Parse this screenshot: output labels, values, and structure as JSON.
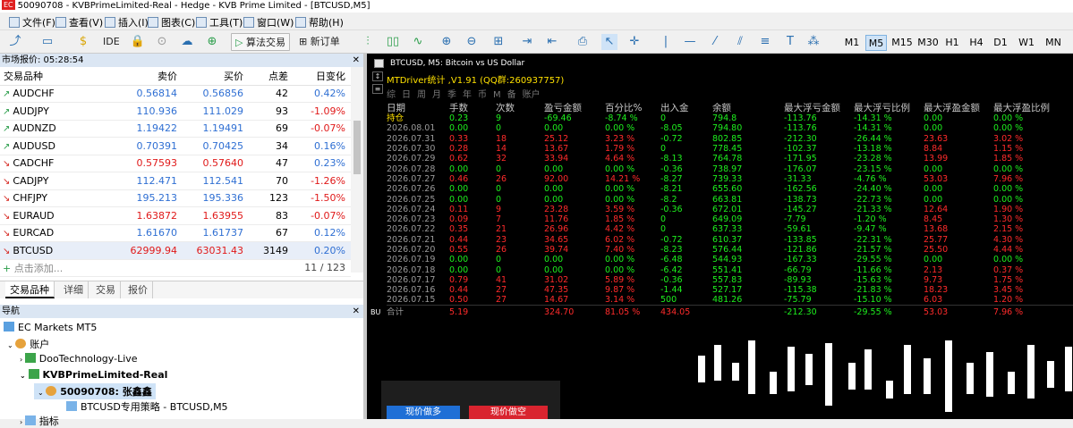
{
  "window_title": "50090708 - KVBPrimeLimited-Real - Hedge - KVB Prime Limited - [BTCUSD,M5]",
  "app_logo": "EC",
  "menu": [
    "文件(F)",
    "查看(V)",
    "插入(I)",
    "图表(C)",
    "工具(T)",
    "窗口(W)",
    "帮助(H)"
  ],
  "toolbar": {
    "ide": "IDE",
    "algo_trading": "算法交易",
    "new_order": "新订单",
    "timeframes": [
      "M1",
      "M5",
      "M15",
      "M30",
      "H1",
      "H4",
      "D1",
      "W1",
      "MN"
    ],
    "active_timeframe": "M5"
  },
  "market_watch": {
    "title": "市场报价: 05:28:54",
    "headers": [
      "交易品种",
      "卖价",
      "买价",
      "点差",
      "日变化"
    ],
    "rows": [
      {
        "symbol": "AUDCHF",
        "dir": "up",
        "bid": "0.56814",
        "ask": "0.56856",
        "spread": "42",
        "change": "0.42%",
        "bid_color": "up",
        "change_color": "up"
      },
      {
        "symbol": "AUDJPY",
        "dir": "up",
        "bid": "110.936",
        "ask": "111.029",
        "spread": "93",
        "change": "-1.09%",
        "bid_color": "up",
        "change_color": "dn"
      },
      {
        "symbol": "AUDNZD",
        "dir": "up",
        "bid": "1.19422",
        "ask": "1.19491",
        "spread": "69",
        "change": "-0.07%",
        "bid_color": "up",
        "change_color": "dn"
      },
      {
        "symbol": "AUDUSD",
        "dir": "up",
        "bid": "0.70391",
        "ask": "0.70425",
        "spread": "34",
        "change": "0.16%",
        "bid_color": "up",
        "change_color": "up"
      },
      {
        "symbol": "CADCHF",
        "dir": "dn",
        "bid": "0.57593",
        "ask": "0.57640",
        "spread": "47",
        "change": "0.23%",
        "bid_color": "dn",
        "change_color": "up"
      },
      {
        "symbol": "CADJPY",
        "dir": "dn",
        "bid": "112.471",
        "ask": "112.541",
        "spread": "70",
        "change": "-1.26%",
        "bid_color": "up",
        "change_color": "dn"
      },
      {
        "symbol": "CHFJPY",
        "dir": "dn",
        "bid": "195.213",
        "ask": "195.336",
        "spread": "123",
        "change": "-1.50%",
        "bid_color": "up",
        "change_color": "dn"
      },
      {
        "symbol": "EURAUD",
        "dir": "dn",
        "bid": "1.63872",
        "ask": "1.63955",
        "spread": "83",
        "change": "-0.07%",
        "bid_color": "dn",
        "change_color": "dn"
      },
      {
        "symbol": "EURCAD",
        "dir": "dn",
        "bid": "1.61670",
        "ask": "1.61737",
        "spread": "67",
        "change": "0.12%",
        "bid_color": "up",
        "change_color": "up"
      },
      {
        "symbol": "BTCUSD",
        "dir": "dn",
        "bid": "62999.94",
        "ask": "63031.43",
        "spread": "3149",
        "change": "0.20%",
        "bid_color": "dn",
        "change_color": "up"
      }
    ],
    "add_label": "点击添加...",
    "count": "11 / 123",
    "tabs": [
      "交易品种",
      "详细",
      "交易",
      "报价"
    ]
  },
  "navigator": {
    "title": "导航",
    "root": "EC Markets MT5",
    "accounts": "账户",
    "account1": "DooTechnology-Live",
    "account2": "KVBPrimeLimited-Real",
    "user": "50090708: 张鑫鑫",
    "strategy": "BTCUSD专用策略 - BTCUSD,M5",
    "next": "指标"
  },
  "chart": {
    "title": "BTCUSD, M5:  Bitcoin vs US Dollar",
    "ea_label": "MTDriver统计 ,V1.91 (QQ群:260937757)",
    "ea_tabs": [
      "综",
      "日",
      "周",
      "月",
      "季",
      "年",
      "币",
      "M",
      "备",
      "账户"
    ],
    "headers": [
      "日期",
      "手数",
      "次数",
      "盈亏金额",
      "百分比%",
      "出入金",
      "余额",
      "最大浮亏金额",
      "最大浮亏比例",
      "最大浮盈金额",
      "最大浮盈比例"
    ],
    "holding_row": [
      "持仓",
      "0.23",
      "9",
      "-69.46",
      "-8.74 %",
      "0",
      "794.8",
      "-113.76",
      "-14.31 %",
      "0.00",
      "0.00 %"
    ],
    "rows": [
      [
        "2026.08.01",
        "0.00",
        "0",
        "0.00",
        "0.00 %",
        "-8.05",
        "794.80",
        "-113.76",
        "-14.31 %",
        "0.00",
        "0.00 %"
      ],
      [
        "2026.07.31",
        "0.33",
        "18",
        "25.12",
        "3.23 %",
        "-0.72",
        "802.85",
        "-212.30",
        "-26.44 %",
        "23.63",
        "3.02 %"
      ],
      [
        "2026.07.30",
        "0.28",
        "14",
        "13.67",
        "1.79 %",
        "0",
        "778.45",
        "-102.37",
        "-13.18 %",
        "8.84",
        "1.15 %"
      ],
      [
        "2026.07.29",
        "0.62",
        "32",
        "33.94",
        "4.64 %",
        "-8.13",
        "764.78",
        "-171.95",
        "-23.28 %",
        "13.99",
        "1.85 %"
      ],
      [
        "2026.07.28",
        "0.00",
        "0",
        "0.00",
        "0.00 %",
        "-0.36",
        "738.97",
        "-176.07",
        "-23.15 %",
        "0.00",
        "0.00 %"
      ],
      [
        "2026.07.27",
        "0.46",
        "26",
        "92.00",
        "14.21 %",
        "-8.27",
        "739.33",
        "-31.33",
        "-4.76 %",
        "53.03",
        "7.96 %"
      ],
      [
        "2026.07.26",
        "0.00",
        "0",
        "0.00",
        "0.00 %",
        "-8.21",
        "655.60",
        "-162.56",
        "-24.40 %",
        "0.00",
        "0.00 %"
      ],
      [
        "2026.07.25",
        "0.00",
        "0",
        "0.00",
        "0.00 %",
        "-8.2",
        "663.81",
        "-138.73",
        "-22.73 %",
        "0.00",
        "0.00 %"
      ],
      [
        "2026.07.24",
        "0.11",
        "9",
        "23.28",
        "3.59 %",
        "-0.36",
        "672.01",
        "-145.27",
        "-21.33 %",
        "12.64",
        "1.90 %"
      ],
      [
        "2026.07.23",
        "0.09",
        "7",
        "11.76",
        "1.85 %",
        "0",
        "649.09",
        "-7.79",
        "-1.20 %",
        "8.45",
        "1.30 %"
      ],
      [
        "2026.07.22",
        "0.35",
        "21",
        "26.96",
        "4.42 %",
        "0",
        "637.33",
        "-59.61",
        "-9.47 %",
        "13.68",
        "2.15 %"
      ],
      [
        "2026.07.21",
        "0.44",
        "23",
        "34.65",
        "6.02 %",
        "-0.72",
        "610.37",
        "-133.85",
        "-22.31 %",
        "25.77",
        "4.30 %"
      ],
      [
        "2026.07.20",
        "0.55",
        "26",
        "39.74",
        "7.40 %",
        "-8.23",
        "576.44",
        "-121.86",
        "-21.57 %",
        "25.50",
        "4.44 %"
      ],
      [
        "2026.07.19",
        "0.00",
        "0",
        "0.00",
        "0.00 %",
        "-6.48",
        "544.93",
        "-167.33",
        "-29.55 %",
        "0.00",
        "0.00 %"
      ],
      [
        "2026.07.18",
        "0.00",
        "0",
        "0.00",
        "0.00 %",
        "-6.42",
        "551.41",
        "-66.79",
        "-11.66 %",
        "2.13",
        "0.37 %"
      ],
      [
        "2026.07.17",
        "0.79",
        "41",
        "31.02",
        "5.89 %",
        "-0.36",
        "557.83",
        "-89.93",
        "-15.63 %",
        "9.73",
        "1.75 %"
      ],
      [
        "2026.07.16",
        "0.44",
        "27",
        "47.35",
        "9.87 %",
        "-1.44",
        "527.17",
        "-115.38",
        "-21.83 %",
        "18.23",
        "3.45 %"
      ],
      [
        "2026.07.15",
        "0.50",
        "27",
        "14.67",
        "3.14 %",
        "500",
        "481.26",
        "-75.79",
        "-15.10 %",
        "6.03",
        "1.20 %"
      ]
    ],
    "totals": [
      "合计",
      "5.19",
      "",
      "324.70",
      "81.05 %",
      "434.05",
      "",
      "-212.30",
      "-29.55 %",
      "53.03",
      "7.96 %"
    ],
    "buy_label": "BU",
    "btn_buy": "现价做多",
    "btn_sell": "现价做空"
  }
}
